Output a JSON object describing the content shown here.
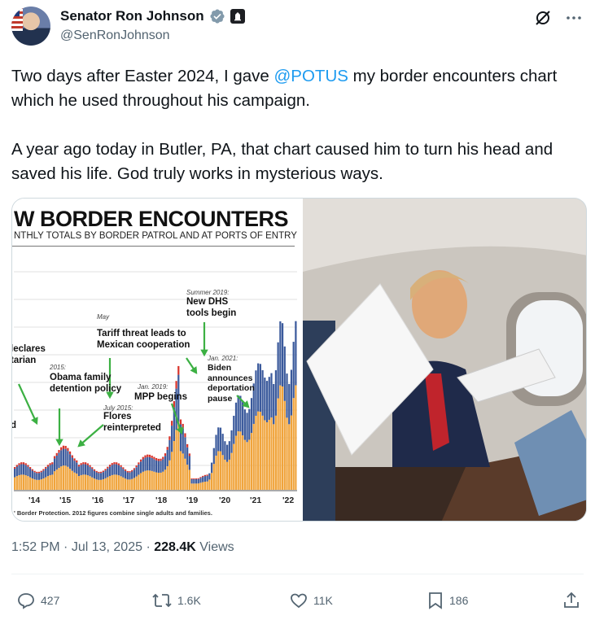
{
  "author": {
    "display_name": "Senator Ron Johnson",
    "handle": "@SenRonJohnson",
    "verified_icon": "verified-badge-gray",
    "affiliation_icon": "government-building-icon"
  },
  "tweet": {
    "line1_pre": "Two days after Easter 2024, I gave ",
    "mention": "@POTUS",
    "line1_post": " my border encounters chart which he used throughout his campaign.",
    "paragraph2": "A year ago today in Butler, PA, that chart caused him to turn his head and saved his life. God truly works in mysterious ways."
  },
  "media_chart": {
    "title": "W BORDER ENCOUNTERS",
    "subtitle": "NTHLY TOTALS BY BORDER PATROL AND AT PORTS OF ENTRY",
    "footnote": "' Border Protection. 2012 figures combine single adults and families.",
    "annotations": {
      "left_cut": "leclares\ntarian",
      "left_d": "d",
      "obama_date": "2015:",
      "obama": "Obama family\ndetention policy",
      "may": "May",
      "tariff": "Tariff threat leads to\nMexican cooperation",
      "flores_date": "July 2015:",
      "flores": "Flores\nreinterpreted",
      "mpp_date": "Jan. 2019:",
      "mpp": "MPP begins",
      "dhs_date": "Summer 2019:",
      "dhs": "New DHS\ntools begin",
      "biden_date": "Jan. 2021:",
      "biden": "Biden\nannounces\ndeportation\npause"
    },
    "x_ticks": [
      "'14",
      "'15",
      "'16",
      "'17",
      "'18",
      "'19",
      "'20",
      "'21",
      "'22"
    ],
    "colors": {
      "orange": "#f0a43c",
      "blue": "#3b5a9c",
      "red": "#d9342b"
    }
  },
  "meta": {
    "time": "1:52 PM",
    "sep1": " · ",
    "date": "Jul 13, 2025",
    "sep2": " · ",
    "views_count": "228.4K",
    "views_label": " Views"
  },
  "actions": {
    "replies": "427",
    "reposts": "1.6K",
    "likes": "11K",
    "bookmarks": "186"
  }
}
